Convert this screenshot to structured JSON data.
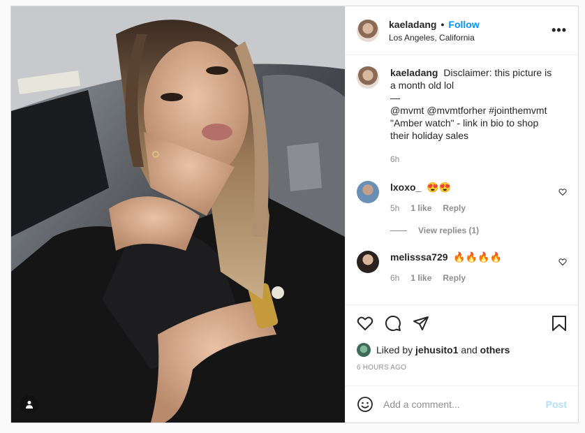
{
  "post": {
    "username": "kaeladang",
    "dot": "•",
    "follow_label": "Follow",
    "location": "Los Angeles, California",
    "more_label": "•••"
  },
  "caption": {
    "username": "kaeladang",
    "lines": [
      "Disclaimer: this picture is a month old lol",
      "—",
      "@mvmt @mvmtforher #jointhemvmt",
      "\"Amber watch\" - link in bio to shop their holiday sales"
    ],
    "time": "6h"
  },
  "comments": [
    {
      "username": "lxoxo_",
      "text": "😍😍",
      "time": "5h",
      "likes": "1 like",
      "reply": "Reply",
      "view_replies": "View replies (1)"
    },
    {
      "username": "melisssa729",
      "text": "🔥🔥🔥🔥",
      "time": "6h",
      "likes": "1 like",
      "reply": "Reply"
    }
  ],
  "likes": {
    "prefix": "Liked by",
    "user": "jehusito1",
    "and": "and",
    "others": "others"
  },
  "time_ago": "6 HOURS AGO",
  "composer": {
    "placeholder": "Add a comment...",
    "post_label": "Post"
  },
  "colors": {
    "accent": "#0095f6",
    "post_disabled": "#b2dffc",
    "muted": "#8e8e8e",
    "border": "#dbdbdb"
  },
  "icons": [
    "user-tag-icon",
    "more-options-icon",
    "heart-icon",
    "comment-icon",
    "share-icon",
    "bookmark-icon",
    "emoji-icon"
  ]
}
